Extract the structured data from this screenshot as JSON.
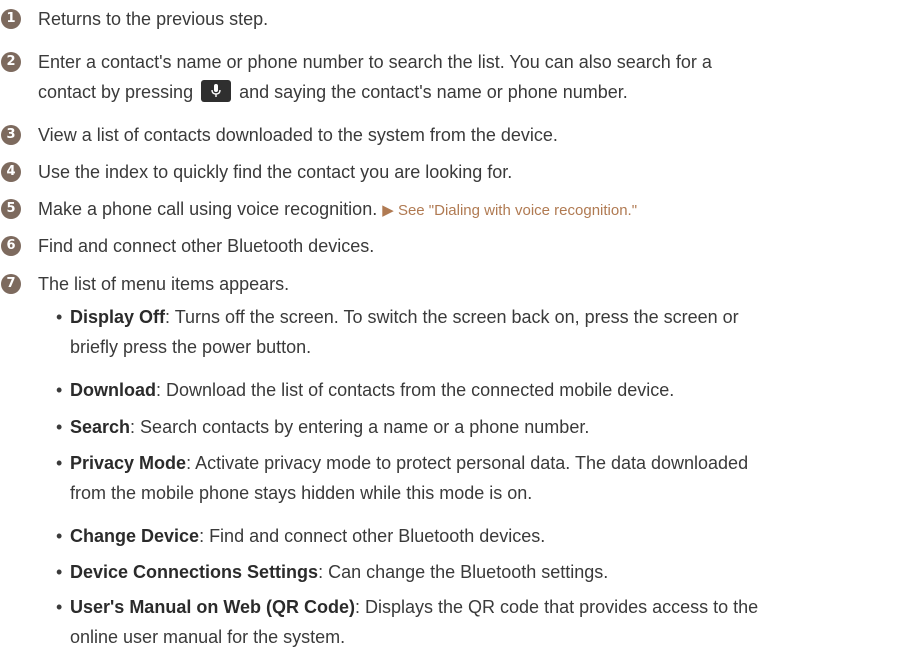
{
  "items": [
    {
      "num": "1",
      "text": "Returns to the previous step."
    },
    {
      "num": "2",
      "text_before": "Enter a contact's name or phone number to search the list. You can also search for a",
      "text_line2_a": "contact by pressing",
      "text_line2_b": "and saying the contact's name or phone number."
    },
    {
      "num": "3",
      "text": "View a list of contacts downloaded to the system from the device."
    },
    {
      "num": "4",
      "text": "Use the index to quickly find the contact you are looking for."
    },
    {
      "num": "5",
      "text": "Make a phone call using voice recognition.",
      "reference": "▶ See \"Dialing with voice recognition.\""
    },
    {
      "num": "6",
      "text": "Find and connect other Bluetooth devices."
    },
    {
      "num": "7",
      "text": "The list of menu items appears."
    }
  ],
  "menu_items": [
    {
      "term": "Display Off",
      "desc_1": ": Turns off the screen. To switch the screen back on, press the screen or",
      "desc_2": "briefly press the power button."
    },
    {
      "term": "Download",
      "desc_1": ": Download the list of contacts from the connected mobile device."
    },
    {
      "term": "Search",
      "desc_1": ": Search contacts by entering a name or a phone number."
    },
    {
      "term": "Privacy Mode",
      "desc_1": ": Activate privacy mode to protect personal data. The data downloaded",
      "desc_2": "from the mobile phone stays hidden while this mode is on."
    },
    {
      "term": "Change Device",
      "desc_1": ": Find and connect other Bluetooth devices."
    },
    {
      "term": "Device Connections Settings",
      "desc_1": ": Can change the Bluetooth settings."
    },
    {
      "term": "User's Manual on Web (QR Code)",
      "desc_1": ": Displays the QR code that provides access to the",
      "desc_2": "online user manual for the system."
    }
  ],
  "bullet_char": "•",
  "icons": {
    "mic": "microphone-icon"
  },
  "colors": {
    "number_circle": "#7d6a5e",
    "reference_link": "#b07a52",
    "mic_button": "#2f2f2f"
  }
}
